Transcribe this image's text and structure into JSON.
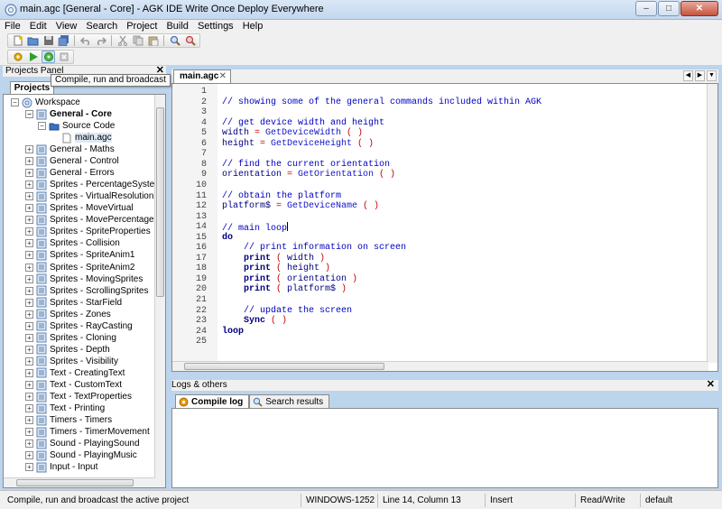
{
  "window": {
    "title": "main.agc [General - Core] - AGK IDE Write Once Deploy Everywhere",
    "min": "–",
    "max": "□",
    "close": "✕"
  },
  "menu": [
    "File",
    "Edit",
    "View",
    "Search",
    "Project",
    "Build",
    "Settings",
    "Help"
  ],
  "tooltip": "Compile, run and broadcast",
  "projects_panel": {
    "title": "Projects Panel",
    "close": "✕",
    "tab": "Projects",
    "workspace": "Workspace",
    "active_project": "General - Core",
    "folder": "Source Code",
    "file": "main.agc",
    "projects": [
      "General - Maths",
      "General - Control",
      "General - Errors",
      "Sprites - PercentageSystem",
      "Sprites - VirtualResolution",
      "Sprites - MoveVirtual",
      "Sprites - MovePercentage",
      "Sprites - SpriteProperties",
      "Sprites - Collision",
      "Sprites - SpriteAnim1",
      "Sprites - SpriteAnim2",
      "Sprites - MovingSprites",
      "Sprites - ScrollingSprites",
      "Sprites - StarField",
      "Sprites - Zones",
      "Sprites - RayCasting",
      "Sprites - Cloning",
      "Sprites - Depth",
      "Sprites - Visibility",
      "Text - CreatingText",
      "Text - CustomText",
      "Text - TextProperties",
      "Text - Printing",
      "Timers - Timers",
      "Timers - TimerMovement",
      "Sound - PlayingSound",
      "Sound - PlayingMusic",
      "Input - Input"
    ]
  },
  "editor": {
    "tab": "main.agc",
    "tab_close": "✕",
    "lines": [
      {
        "n": "1",
        "parts": []
      },
      {
        "n": "2",
        "parts": [
          {
            "t": "// showing some of the general commands included within AGK",
            "c": "c-com"
          }
        ]
      },
      {
        "n": "3",
        "parts": []
      },
      {
        "n": "4",
        "parts": [
          {
            "t": "// get device width and height",
            "c": "c-com"
          }
        ]
      },
      {
        "n": "5",
        "parts": [
          {
            "t": "width",
            "c": "c-id"
          },
          {
            "t": " = ",
            "c": "c-pun"
          },
          {
            "t": "GetDeviceWidth",
            "c": "c-fn"
          },
          {
            "t": " ( )",
            "c": "c-pun"
          }
        ]
      },
      {
        "n": "6",
        "parts": [
          {
            "t": "height",
            "c": "c-id"
          },
          {
            "t": " = ",
            "c": "c-pun"
          },
          {
            "t": "GetDeviceHeight",
            "c": "c-fn"
          },
          {
            "t": " ( )",
            "c": "c-pun"
          }
        ]
      },
      {
        "n": "7",
        "parts": []
      },
      {
        "n": "8",
        "parts": [
          {
            "t": "// find the current orientation",
            "c": "c-com"
          }
        ]
      },
      {
        "n": "9",
        "parts": [
          {
            "t": "orientation",
            "c": "c-id"
          },
          {
            "t": " = ",
            "c": "c-pun"
          },
          {
            "t": "GetOrientation",
            "c": "c-fn"
          },
          {
            "t": " ( )",
            "c": "c-pun"
          }
        ]
      },
      {
        "n": "10",
        "parts": []
      },
      {
        "n": "11",
        "parts": [
          {
            "t": "// obtain the platform",
            "c": "c-com"
          }
        ]
      },
      {
        "n": "12",
        "parts": [
          {
            "t": "platform$",
            "c": "c-id"
          },
          {
            "t": " = ",
            "c": "c-pun"
          },
          {
            "t": "GetDeviceName",
            "c": "c-fn"
          },
          {
            "t": " ( )",
            "c": "c-pun"
          }
        ]
      },
      {
        "n": "13",
        "parts": []
      },
      {
        "n": "14",
        "parts": [
          {
            "t": "// main loop",
            "c": "c-com"
          }
        ],
        "cursor": true
      },
      {
        "n": "15",
        "parts": [
          {
            "t": "do",
            "c": "c-kw"
          }
        ]
      },
      {
        "n": "16",
        "parts": [
          {
            "t": "    // print information on screen",
            "c": "c-com"
          }
        ]
      },
      {
        "n": "17",
        "parts": [
          {
            "t": "    print",
            "c": "c-kw"
          },
          {
            "t": " ( ",
            "c": "c-pun"
          },
          {
            "t": "width",
            "c": "c-id"
          },
          {
            "t": " )",
            "c": "c-pun"
          }
        ]
      },
      {
        "n": "18",
        "parts": [
          {
            "t": "    print",
            "c": "c-kw"
          },
          {
            "t": " ( ",
            "c": "c-pun"
          },
          {
            "t": "height",
            "c": "c-id"
          },
          {
            "t": " )",
            "c": "c-pun"
          }
        ]
      },
      {
        "n": "19",
        "parts": [
          {
            "t": "    print",
            "c": "c-kw"
          },
          {
            "t": " ( ",
            "c": "c-pun"
          },
          {
            "t": "orientation",
            "c": "c-id"
          },
          {
            "t": " )",
            "c": "c-pun"
          }
        ]
      },
      {
        "n": "20",
        "parts": [
          {
            "t": "    print",
            "c": "c-kw"
          },
          {
            "t": " ( ",
            "c": "c-pun"
          },
          {
            "t": "platform$",
            "c": "c-id"
          },
          {
            "t": " )",
            "c": "c-pun"
          }
        ]
      },
      {
        "n": "21",
        "parts": []
      },
      {
        "n": "22",
        "parts": [
          {
            "t": "    // update the screen",
            "c": "c-com"
          }
        ]
      },
      {
        "n": "23",
        "parts": [
          {
            "t": "    Sync",
            "c": "c-kw"
          },
          {
            "t": " ( )",
            "c": "c-pun"
          }
        ]
      },
      {
        "n": "24",
        "parts": [
          {
            "t": "loop",
            "c": "c-kw"
          }
        ]
      },
      {
        "n": "25",
        "parts": []
      }
    ]
  },
  "logs": {
    "title": "Logs & others",
    "close": "✕",
    "tabs": [
      "Compile log",
      "Search results"
    ]
  },
  "status": {
    "message": "Compile, run and broadcast the active project",
    "encoding": "WINDOWS-1252",
    "position": "Line 14, Column 13",
    "mode": "Insert",
    "access": "Read/Write",
    "profile": "default"
  }
}
